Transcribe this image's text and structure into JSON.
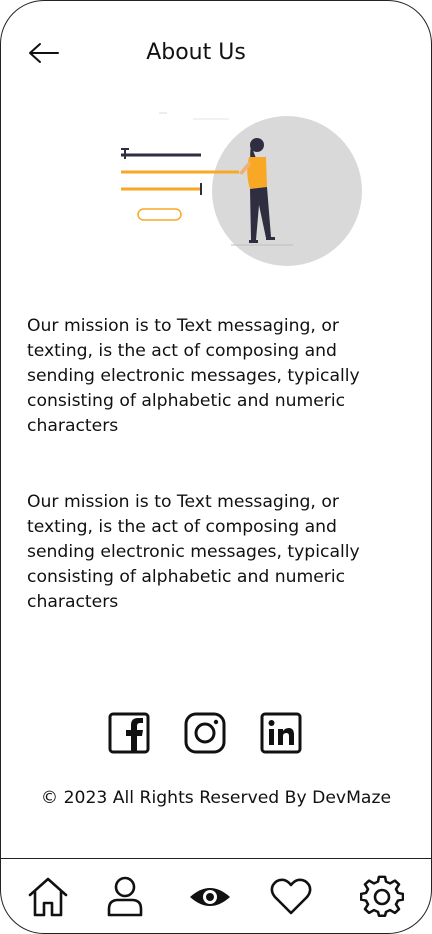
{
  "header": {
    "title": "About Us",
    "back_icon": "arrow-left-icon"
  },
  "illustration": {
    "name": "woman-presenting-illustration",
    "accent_color": "#f9a826",
    "circle_color": "#d9d9d9",
    "dark_color": "#2f2e41"
  },
  "content": {
    "paragraphs": [
      "Our mission is to Text messaging, or texting, is the act of composing and sending electronic messages, typically consisting of alphabetic and numeric characters",
      "Our mission is to Text messaging, or texting, is the act of composing and sending electronic messages, typically consisting of alphabetic and numeric characters"
    ]
  },
  "social": {
    "icons": [
      "facebook-icon",
      "instagram-icon",
      "linkedin-icon"
    ]
  },
  "footer": {
    "copyright": "© 2023 All Rights Reserved By DevMaze"
  },
  "tabbar": {
    "items": [
      "home-icon",
      "user-icon",
      "eye-icon",
      "heart-icon",
      "gear-icon"
    ],
    "active": "eye-icon"
  }
}
